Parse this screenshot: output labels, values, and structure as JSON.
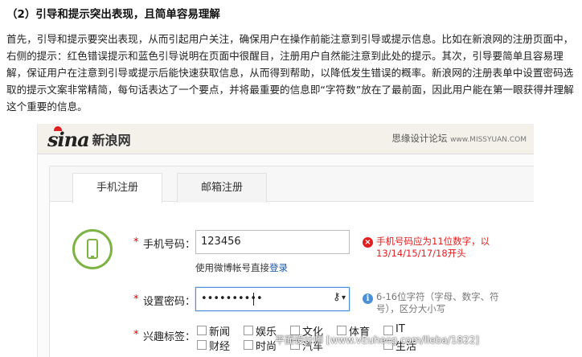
{
  "article": {
    "heading": "（2）引导和提示突出表现，且简单容易理解",
    "paragraph": "首先，引导和提示要突出表现，从而引起用户关注，确保用户在操作前能注意到引导或提示信息。比如在新浪网的注册页面中，右侧的提示：红色错误提示和蓝色引导说明在页面中很醒目，注册用户自然能注意到此处的提示。其次，引导要简单且容易理解，保证用户在注意到引导或提示后能快速获取信息，从而得到帮助，以降低发生错误的概率。新浪网的注册表单中设置密码选取的提示文案非常精简，每句话表达了一个要点，并将最重要的信息即“字符数”放在了最前面，因此用户能在第一眼获得并理解这个重要的信息。"
  },
  "screenshot": {
    "logo_text": "sina",
    "logo_cn": "新浪网",
    "watermark_top": "思缘设计论坛",
    "watermark_domain": "www.MISSYUAN.COM",
    "tabs": [
      {
        "label": "手机注册",
        "active": true
      },
      {
        "label": "邮箱注册",
        "active": false
      }
    ],
    "icon_phone": "mobile-phone-icon",
    "form": {
      "phone_label": "手机号码：",
      "phone_value": "123456",
      "phone_hint_prefix": "使用微博帐号直接",
      "phone_hint_link": "登录",
      "phone_error": "手机号码应为11位数字，以13/14/15/17/18开头",
      "password_label": "设置密码：",
      "password_value": "••••••••••",
      "password_info": "6-16位字符（字母、数字、符号），区分大小写",
      "interest_label": "兴趣标签：",
      "interests": [
        "新闻",
        "娱乐",
        "文化",
        "体育",
        "IT",
        "财经",
        "时尚",
        "汽车",
        "",
        "生活"
      ]
    },
    "bottom_watermark": "平面设计师 [www.vEuhecg.com/lleba/1822]"
  },
  "colors": {
    "error": "#e02020",
    "info": "#4a90d9",
    "phone_icon": "#7cb342",
    "link": "#1a5aa6"
  }
}
